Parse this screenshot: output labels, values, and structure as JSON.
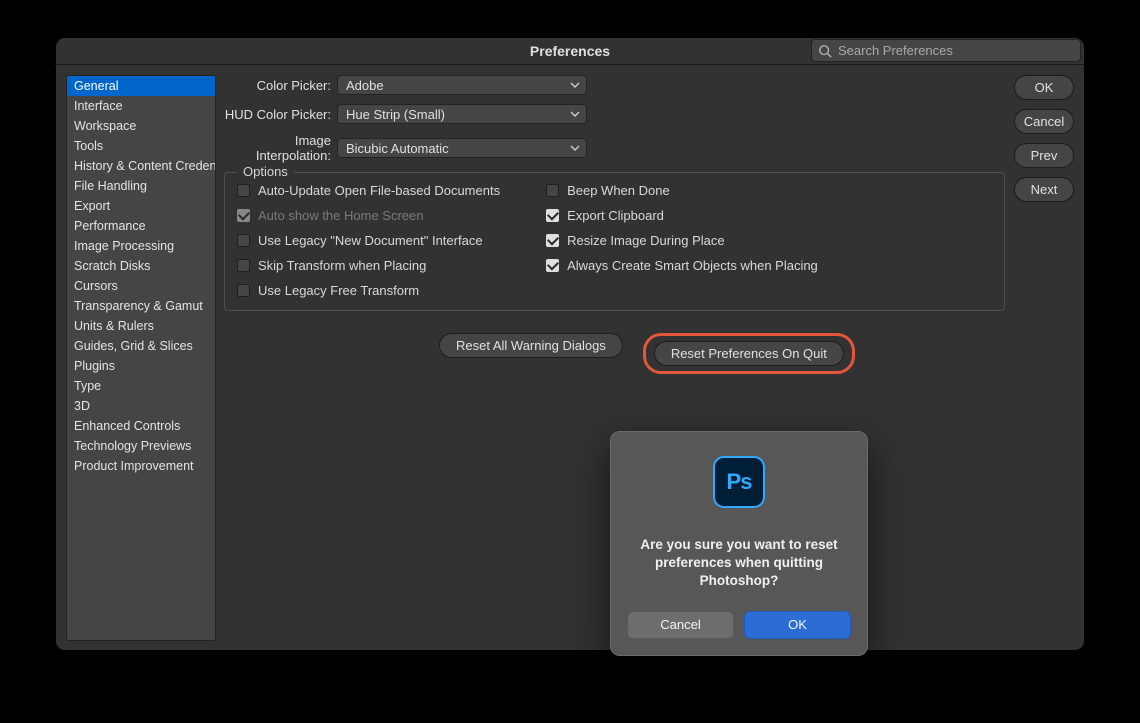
{
  "title": "Preferences",
  "search": {
    "placeholder": "Search Preferences"
  },
  "sidebar": {
    "items": [
      {
        "label": "General",
        "selected": true
      },
      {
        "label": "Interface"
      },
      {
        "label": "Workspace"
      },
      {
        "label": "Tools"
      },
      {
        "label": "History & Content Credentials"
      },
      {
        "label": "File Handling"
      },
      {
        "label": "Export"
      },
      {
        "label": "Performance"
      },
      {
        "label": "Image Processing"
      },
      {
        "label": "Scratch Disks"
      },
      {
        "label": "Cursors"
      },
      {
        "label": "Transparency & Gamut"
      },
      {
        "label": "Units & Rulers"
      },
      {
        "label": "Guides, Grid & Slices"
      },
      {
        "label": "Plugins"
      },
      {
        "label": "Type"
      },
      {
        "label": "3D"
      },
      {
        "label": "Enhanced Controls"
      },
      {
        "label": "Technology Previews"
      },
      {
        "label": "Product Improvement"
      }
    ]
  },
  "form": {
    "color_picker_label": "Color Picker:",
    "color_picker_value": "Adobe",
    "hud_label": "HUD Color Picker:",
    "hud_value": "Hue Strip (Small)",
    "interp_label": "Image Interpolation:",
    "interp_value": "Bicubic Automatic"
  },
  "options": {
    "legend": "Options",
    "left": [
      {
        "label": "Auto-Update Open File-based Documents",
        "checked": false,
        "disabled": false
      },
      {
        "label": "Auto show the Home Screen",
        "checked": true,
        "disabled": true
      },
      {
        "label": "Use Legacy \"New Document\" Interface",
        "checked": false,
        "disabled": false
      },
      {
        "label": "Skip Transform when Placing",
        "checked": false,
        "disabled": false
      },
      {
        "label": "Use Legacy Free Transform",
        "checked": false,
        "disabled": false
      }
    ],
    "right": [
      {
        "label": "Beep When Done",
        "checked": false
      },
      {
        "label": "Export Clipboard",
        "checked": true
      },
      {
        "label": "Resize Image During Place",
        "checked": true
      },
      {
        "label": "Always Create Smart Objects when Placing",
        "checked": true
      }
    ]
  },
  "reset": {
    "warning": "Reset All Warning Dialogs",
    "onquit": "Reset Preferences On Quit"
  },
  "right_buttons": {
    "ok": "OK",
    "cancel": "Cancel",
    "prev": "Prev",
    "next": "Next"
  },
  "modal": {
    "icon_text": "Ps",
    "message": "Are you sure you want to reset preferences when quitting Photoshop?",
    "cancel": "Cancel",
    "ok": "OK"
  }
}
